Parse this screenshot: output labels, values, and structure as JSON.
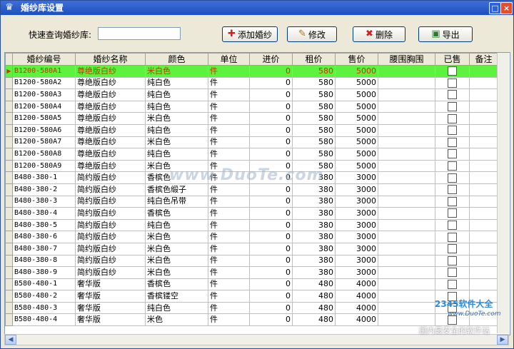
{
  "window": {
    "title": "婚纱库设置"
  },
  "toolbar": {
    "search_label": "快速查询婚纱库:",
    "search_value": "",
    "add_label": "添加婚纱",
    "edit_label": "修改",
    "delete_label": "删除",
    "export_label": "导出"
  },
  "columns": [
    "婚纱编号",
    "婚纱名称",
    "颜色",
    "单位",
    "进价",
    "租价",
    "售价",
    "腰围胸围",
    "已售",
    "备注"
  ],
  "rows": [
    {
      "id": "B1200-580A1",
      "name": "尊绝版白纱",
      "color": "米白色",
      "unit": "件",
      "cost": "0",
      "rent": "580",
      "price": "5000",
      "sold": false,
      "selected": true
    },
    {
      "id": "B1200-580A2",
      "name": "尊绝版白纱",
      "color": "纯白色",
      "unit": "件",
      "cost": "0",
      "rent": "580",
      "price": "5000",
      "sold": false
    },
    {
      "id": "B1200-580A3",
      "name": "尊绝版白纱",
      "color": "纯白色",
      "unit": "件",
      "cost": "0",
      "rent": "580",
      "price": "5000",
      "sold": false
    },
    {
      "id": "B1200-580A4",
      "name": "尊绝版白纱",
      "color": "纯白色",
      "unit": "件",
      "cost": "0",
      "rent": "580",
      "price": "5000",
      "sold": false
    },
    {
      "id": "B1200-580A5",
      "name": "尊绝版白纱",
      "color": "米白色",
      "unit": "件",
      "cost": "0",
      "rent": "580",
      "price": "5000",
      "sold": false
    },
    {
      "id": "B1200-580A6",
      "name": "尊绝版白纱",
      "color": "纯白色",
      "unit": "件",
      "cost": "0",
      "rent": "580",
      "price": "5000",
      "sold": false
    },
    {
      "id": "B1200-580A7",
      "name": "尊绝版白纱",
      "color": "米白色",
      "unit": "件",
      "cost": "0",
      "rent": "580",
      "price": "5000",
      "sold": false
    },
    {
      "id": "B1200-580A8",
      "name": "尊绝版白纱",
      "color": "纯白色",
      "unit": "件",
      "cost": "0",
      "rent": "580",
      "price": "5000",
      "sold": false
    },
    {
      "id": "B1200-580A9",
      "name": "尊绝版白纱",
      "color": "米白色",
      "unit": "件",
      "cost": "0",
      "rent": "580",
      "price": "5000",
      "sold": false
    },
    {
      "id": "B480-380-1",
      "name": "简约版白纱",
      "color": "香槟色",
      "unit": "件",
      "cost": "0",
      "rent": "380",
      "price": "3000",
      "sold": false
    },
    {
      "id": "B480-380-2",
      "name": "简约版白纱",
      "color": "香槟色缎子",
      "unit": "件",
      "cost": "0",
      "rent": "380",
      "price": "3000",
      "sold": false
    },
    {
      "id": "B480-380-3",
      "name": "简约版白纱",
      "color": "纯白色吊带",
      "unit": "件",
      "cost": "0",
      "rent": "380",
      "price": "3000",
      "sold": false
    },
    {
      "id": "B480-380-4",
      "name": "简约版白纱",
      "color": "香槟色",
      "unit": "件",
      "cost": "0",
      "rent": "380",
      "price": "3000",
      "sold": false
    },
    {
      "id": "B480-380-5",
      "name": "简约版白纱",
      "color": "纯白色",
      "unit": "件",
      "cost": "0",
      "rent": "380",
      "price": "3000",
      "sold": false
    },
    {
      "id": "B480-380-6",
      "name": "简约版白纱",
      "color": "米白色",
      "unit": "件",
      "cost": "0",
      "rent": "380",
      "price": "3000",
      "sold": false
    },
    {
      "id": "B480-380-7",
      "name": "简约版白纱",
      "color": "米白色",
      "unit": "件",
      "cost": "0",
      "rent": "380",
      "price": "3000",
      "sold": false
    },
    {
      "id": "B480-380-8",
      "name": "简约版白纱",
      "color": "米白色",
      "unit": "件",
      "cost": "0",
      "rent": "380",
      "price": "3000",
      "sold": false
    },
    {
      "id": "B480-380-9",
      "name": "简约版白纱",
      "color": "米白色",
      "unit": "件",
      "cost": "0",
      "rent": "380",
      "price": "3000",
      "sold": false
    },
    {
      "id": "B580-480-1",
      "name": "奢华版",
      "color": "香槟色",
      "unit": "件",
      "cost": "0",
      "rent": "480",
      "price": "4000",
      "sold": false
    },
    {
      "id": "B580-480-2",
      "name": "奢华版",
      "color": "香槟镂空",
      "unit": "件",
      "cost": "0",
      "rent": "480",
      "price": "4000",
      "sold": false
    },
    {
      "id": "B580-480-3",
      "name": "奢华版",
      "color": "纯白色",
      "unit": "件",
      "cost": "0",
      "rent": "480",
      "price": "4000",
      "sold": false
    },
    {
      "id": "B580-480-4",
      "name": "奢华版",
      "color": "米色",
      "unit": "件",
      "cost": "0",
      "rent": "480",
      "price": "4000",
      "sold": false
    }
  ],
  "watermark": "www.DuoTe.com",
  "logo": {
    "brand": "2345软件大全",
    "url": "www.DuoTe.com",
    "slogan": "国内最安全的软件站"
  },
  "colors": {
    "selected_row": "#5df23e",
    "selected_text": "#d03000",
    "titlebar": "#1c4fc0"
  },
  "icons": {
    "app": "dress-icon",
    "add": "plus-icon",
    "edit": "pencil-icon",
    "delete": "x-icon",
    "export": "export-icon"
  }
}
